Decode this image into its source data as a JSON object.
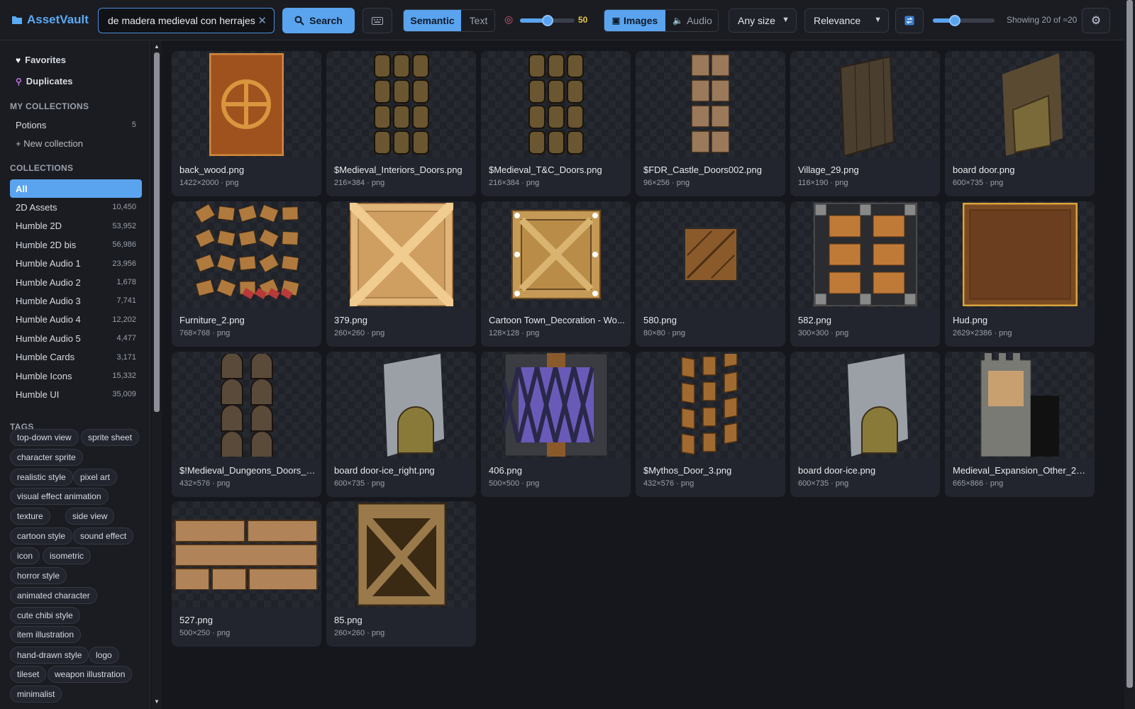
{
  "app": {
    "name": "AssetVault"
  },
  "search": {
    "query": "de madera medieval con herrajes",
    "button_label": "Search"
  },
  "mode": {
    "semantic_label": "Semantic",
    "text_label": "Text",
    "active": "Semantic"
  },
  "weight": {
    "value": "50",
    "fraction": 0.5
  },
  "media": {
    "images_label": "Images",
    "audio_label": "Audio",
    "active": "Images"
  },
  "size_filter": {
    "selected": "Any size"
  },
  "sort": {
    "selected": "Relevance"
  },
  "thumb_size": {
    "fraction": 0.36
  },
  "status": {
    "text": "Showing 20 of ≈20"
  },
  "sidebar": {
    "favorites_label": "Favorites",
    "duplicates_label": "Duplicates",
    "my_collections_heading": "MY COLLECTIONS",
    "my_collections": [
      {
        "label": "Potions",
        "count": "5"
      }
    ],
    "new_collection_label": "+ New collection",
    "collections_heading": "COLLECTIONS",
    "collections": [
      {
        "label": "All",
        "count": ""
      },
      {
        "label": "2D Assets",
        "count": "10,450"
      },
      {
        "label": "Humble 2D",
        "count": "53,952"
      },
      {
        "label": "Humble 2D bis",
        "count": "56,986"
      },
      {
        "label": "Humble Audio 1",
        "count": "23,956"
      },
      {
        "label": "Humble Audio 2",
        "count": "1,678"
      },
      {
        "label": "Humble Audio 3",
        "count": "7,741"
      },
      {
        "label": "Humble Audio 4",
        "count": "12,202"
      },
      {
        "label": "Humble Audio 5",
        "count": "4,477"
      },
      {
        "label": "Humble Cards",
        "count": "3,171"
      },
      {
        "label": "Humble Icons",
        "count": "15,332"
      },
      {
        "label": "Humble UI",
        "count": "35,009"
      }
    ],
    "tags_heading": "TAGS",
    "tags": [
      "top-down view",
      "sprite sheet",
      "character sprite",
      "realistic style",
      "pixel art",
      "visual effect animation",
      "texture",
      "side view",
      "cartoon style",
      "sound effect",
      "icon",
      "isometric",
      "horror style",
      "animated character",
      "cute chibi style",
      "item illustration",
      "hand-drawn style",
      "logo",
      "tileset",
      "weapon illustration",
      "minimalist"
    ]
  },
  "results": [
    {
      "name": "back_wood.png",
      "meta": "1422×2000 · png"
    },
    {
      "name": "$Medieval_Interiors_Doors.png",
      "meta": "216×384 · png"
    },
    {
      "name": "$Medieval_T&C_Doors.png",
      "meta": "216×384 · png"
    },
    {
      "name": "$FDR_Castle_Doors002.png",
      "meta": "96×256 · png"
    },
    {
      "name": "Village_29.png",
      "meta": "116×190 · png"
    },
    {
      "name": "board door.png",
      "meta": "600×735 · png"
    },
    {
      "name": "Furniture_2.png",
      "meta": "768×768 · png"
    },
    {
      "name": "379.png",
      "meta": "260×260 · png"
    },
    {
      "name": "Cartoon Town_Decoration - Wo...",
      "meta": "128×128 · png"
    },
    {
      "name": "580.png",
      "meta": "80×80 · png"
    },
    {
      "name": "582.png",
      "meta": "300×300 · png"
    },
    {
      "name": "Hud.png",
      "meta": "2629×2386 · png"
    },
    {
      "name": "$!Medieval_Dungeons_Doors_1....",
      "meta": "432×576 · png"
    },
    {
      "name": "board door-ice_right.png",
      "meta": "600×735 · png"
    },
    {
      "name": "406.png",
      "meta": "500×500 · png"
    },
    {
      "name": "$Mythos_Door_3.png",
      "meta": "432×576 · png"
    },
    {
      "name": "board door-ice.png",
      "meta": "600×735 · png"
    },
    {
      "name": "Medieval_Expansion_Other_27.p...",
      "meta": "665×866 · png"
    },
    {
      "name": "527.png",
      "meta": "500×250 · png"
    },
    {
      "name": "85.png",
      "meta": "260×260 · png"
    }
  ],
  "colors": {
    "accent": "#5aa4ef",
    "background": "#15171c",
    "panel": "#1a1c22",
    "card": "#22252d"
  }
}
